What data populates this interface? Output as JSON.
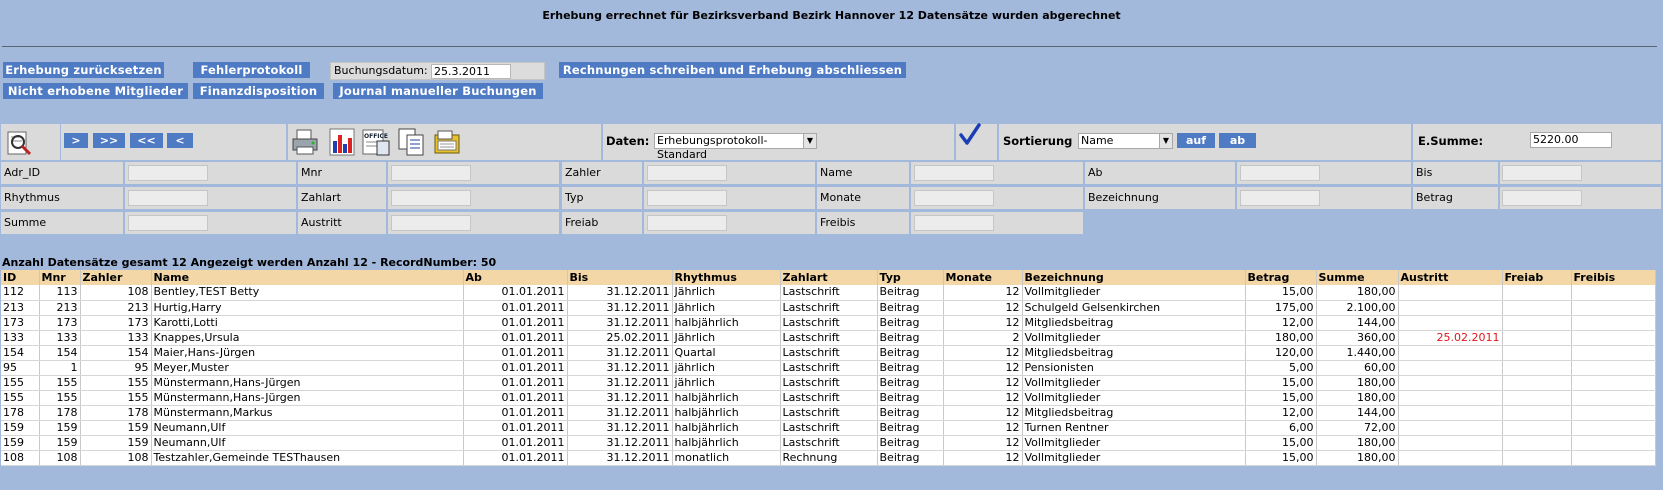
{
  "header": {
    "title": "Erhebung errechnet für Bezirksverband Bezirk Hannover 12 Datensätze wurden abgerechnet"
  },
  "actions": {
    "reset": "Erhebung zurücksetzen",
    "error_log": "Fehlerprotokoll",
    "booking_date_label": "Buchungsdatum:",
    "booking_date_value": "25.3.2011",
    "write_invoices": "Rechnungen schreiben und Erhebung abschliessen",
    "not_collected": "Nicht erhobene Mitglieder",
    "finance": "Finanzdisposition",
    "journal": "Journal manueller Buchungen"
  },
  "toolbar": {
    "nav_next": ">",
    "nav_last": ">>",
    "nav_first": "<<",
    "nav_prev": "<",
    "data_label": "Daten:",
    "data_value": "Erhebungsprotokoll-Standard",
    "sort_label": "Sortierung",
    "sort_value": "Name",
    "sort_asc": "auf",
    "sort_desc": "ab",
    "esum_label": "E.Summe:",
    "esum_value": "5220.00",
    "icons": [
      "search-report-icon",
      "print-icon",
      "chart-icon",
      "office-export-icon",
      "copy-icon",
      "export-icon",
      "confirm-check-icon"
    ]
  },
  "filters": {
    "row1": [
      "Adr_ID",
      "Mnr",
      "Zahler",
      "Name",
      "Ab",
      "Bis"
    ],
    "row2": [
      "Rhythmus",
      "Zahlart",
      "Typ",
      "Monate",
      "Bezeichnung",
      "Betrag"
    ],
    "row3": [
      "Summe",
      "Austritt",
      "Freiab",
      "Freibis"
    ]
  },
  "summary": "Anzahl Datensätze gesamt 12 Angezeigt werden Anzahl 12 - RecordNumber: 50",
  "table": {
    "headers": [
      "ID",
      "Mnr",
      "Zahler",
      "Name",
      "Ab",
      "Bis",
      "Rhythmus",
      "Zahlart",
      "Typ",
      "Monate",
      "Bezeichnung",
      "Betrag",
      "Summe",
      "Austritt",
      "Freiab",
      "Freibis"
    ],
    "rows": [
      [
        "112",
        "113",
        "108",
        "Bentley,TEST Betty",
        "01.01.2011",
        "31.12.2011",
        "Jährlich",
        "Lastschrift",
        "Beitrag",
        "12",
        "Vollmitglieder",
        "15,00",
        "180,00",
        "",
        "",
        ""
      ],
      [
        "213",
        "213",
        "213",
        "Hurtig,Harry",
        "01.01.2011",
        "31.12.2011",
        "Jährlich",
        "Lastschrift",
        "Beitrag",
        "12",
        "Schulgeld Gelsenkirchen",
        "175,00",
        "2.100,00",
        "",
        "",
        ""
      ],
      [
        "173",
        "173",
        "173",
        "Karotti,Lotti",
        "01.01.2011",
        "31.12.2011",
        "halbjährlich",
        "Lastschrift",
        "Beitrag",
        "12",
        "Mitgliedsbeitrag",
        "12,00",
        "144,00",
        "",
        "",
        ""
      ],
      [
        "133",
        "133",
        "133",
        "Knappes,Ursula",
        "01.01.2011",
        "25.02.2011",
        "Jährlich",
        "Lastschrift",
        "Beitrag",
        "2",
        "Vollmitglieder",
        "180,00",
        "360,00",
        "25.02.2011",
        "",
        ""
      ],
      [
        "154",
        "154",
        "154",
        "Maier,Hans-Jürgen",
        "01.01.2011",
        "31.12.2011",
        "Quartal",
        "Lastschrift",
        "Beitrag",
        "12",
        "Mitgliedsbeitrag",
        "120,00",
        "1.440,00",
        "",
        "",
        ""
      ],
      [
        "95",
        "1",
        "95",
        "Meyer,Muster",
        "01.01.2011",
        "31.12.2011",
        "jährlich",
        "Lastschrift",
        "Beitrag",
        "12",
        "Pensionisten",
        "5,00",
        "60,00",
        "",
        "",
        ""
      ],
      [
        "155",
        "155",
        "155",
        "Münstermann,Hans-Jürgen",
        "01.01.2011",
        "31.12.2011",
        "jährlich",
        "Lastschrift",
        "Beitrag",
        "12",
        "Vollmitglieder",
        "15,00",
        "180,00",
        "",
        "",
        ""
      ],
      [
        "155",
        "155",
        "155",
        "Münstermann,Hans-Jürgen",
        "01.01.2011",
        "31.12.2011",
        "halbjährlich",
        "Lastschrift",
        "Beitrag",
        "12",
        "Vollmitglieder",
        "15,00",
        "180,00",
        "",
        "",
        ""
      ],
      [
        "178",
        "178",
        "178",
        "Münstermann,Markus",
        "01.01.2011",
        "31.12.2011",
        "halbjährlich",
        "Lastschrift",
        "Beitrag",
        "12",
        "Mitgliedsbeitrag",
        "12,00",
        "144,00",
        "",
        "",
        ""
      ],
      [
        "159",
        "159",
        "159",
        "Neumann,Ulf",
        "01.01.2011",
        "31.12.2011",
        "halbjährlich",
        "Lastschrift",
        "Beitrag",
        "12",
        "Turnen Rentner",
        "6,00",
        "72,00",
        "",
        "",
        ""
      ],
      [
        "159",
        "159",
        "159",
        "Neumann,Ulf",
        "01.01.2011",
        "31.12.2011",
        "halbjährlich",
        "Lastschrift",
        "Beitrag",
        "12",
        "Vollmitglieder",
        "15,00",
        "180,00",
        "",
        "",
        ""
      ],
      [
        "108",
        "108",
        "108",
        "Testzahler,Gemeinde TESThausen",
        "01.01.2011",
        "31.12.2011",
        "monatlich",
        "Rechnung",
        "Beitrag",
        "12",
        "Vollmitglieder",
        "15,00",
        "180,00",
        "",
        "",
        ""
      ]
    ],
    "highlight_color": "#e0161b"
  }
}
